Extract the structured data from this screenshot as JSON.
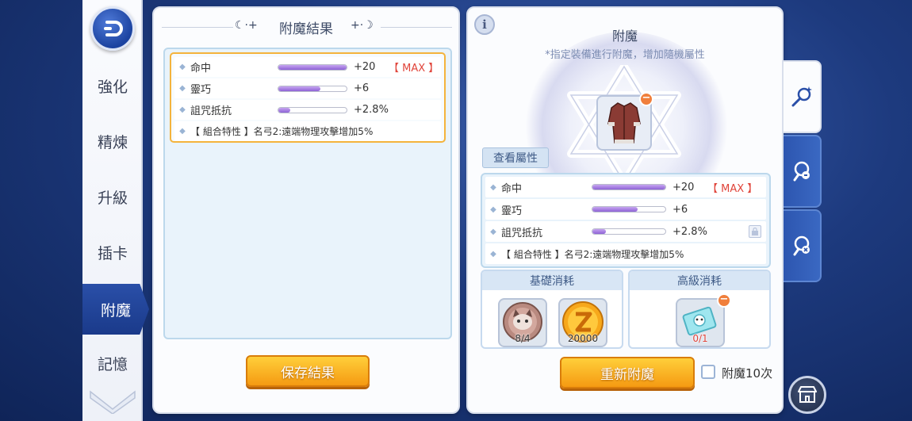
{
  "nav": {
    "items": [
      {
        "label": "強化",
        "active": false
      },
      {
        "label": "精煉",
        "active": false
      },
      {
        "label": "升級",
        "active": false
      },
      {
        "label": "插卡",
        "active": false
      },
      {
        "label": "附魔",
        "active": true
      },
      {
        "label": "記憶",
        "active": false
      }
    ]
  },
  "result_panel": {
    "title": "附魔結果",
    "attributes": [
      {
        "name": "命中",
        "value": "+20",
        "fill": 1.0,
        "max_tag": "【 MAX 】"
      },
      {
        "name": "靈巧",
        "value": "+6",
        "fill": 0.62,
        "max_tag": ""
      },
      {
        "name": "詛咒抵抗",
        "value": "+2.8%",
        "fill": 0.18,
        "max_tag": ""
      }
    ],
    "combo": "【 組合特性 】名弓2:遠端物理攻擊增加5%",
    "save_button": "保存結果"
  },
  "enchant_panel": {
    "info_icon": "i",
    "title": "附魔",
    "subtitle": "*指定裝備進行附魔，增加隨機屬性",
    "view_attributes": "查看屬性",
    "attributes": [
      {
        "name": "命中",
        "value": "+20",
        "fill": 1.0,
        "max_tag": "【 MAX 】",
        "locked": false
      },
      {
        "name": "靈巧",
        "value": "+6",
        "fill": 0.62,
        "max_tag": "",
        "locked": false
      },
      {
        "name": "詛咒抵抗",
        "value": "+2.8%",
        "fill": 0.18,
        "max_tag": "",
        "locked": true
      }
    ],
    "combo": "【 組合特性 】名弓2:遠端物理攻擊增加5%",
    "basic_cost": {
      "title": "基礎消耗",
      "items": [
        {
          "icon": "cat-coin-icon",
          "count": "8/4"
        },
        {
          "icon": "zeny-coin-icon",
          "count": "20000"
        }
      ]
    },
    "advanced_cost": {
      "title": "高級消耗",
      "items": [
        {
          "icon": "enchant-ticket-icon",
          "count": "0/1",
          "count_color": "#e0443a"
        }
      ]
    },
    "reenchant_button": "重新附魔",
    "enchant10_label": "附魔10次"
  },
  "side_tabs": [
    {
      "icon": "enchant-wand-icon",
      "active": true
    },
    {
      "icon": "enchant-refresh-icon",
      "active": false
    },
    {
      "icon": "enchant-swap-icon",
      "active": false
    }
  ],
  "colors": {
    "accent_orange": "#f59a12",
    "max_red": "#e0443a",
    "bar_purple": "#8d62d6",
    "nav_active": "#1a3a8a"
  }
}
